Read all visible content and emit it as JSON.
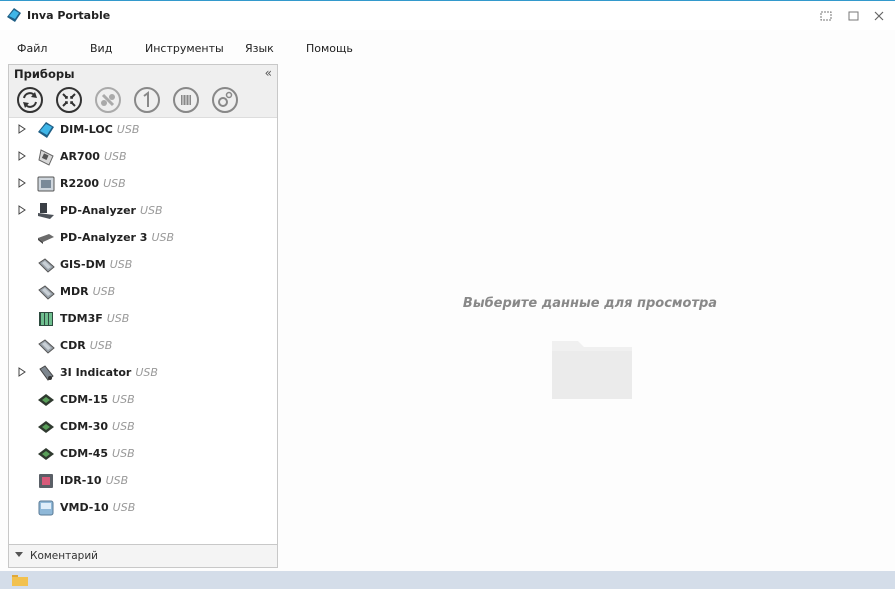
{
  "window": {
    "title": "Inva Portable",
    "accent": "#3399cc",
    "buttons": {
      "restore_icon": "restore-icon",
      "maximize_icon": "maximize-icon",
      "close_icon": "close-icon"
    }
  },
  "menu": {
    "items": [
      {
        "label": "Файл"
      },
      {
        "label": "Вид"
      },
      {
        "label": "Инструменты"
      },
      {
        "label": "Язык"
      },
      {
        "label": "Помощь"
      }
    ]
  },
  "sidebar": {
    "title": "Приборы",
    "collapse_glyph": "«",
    "toolbar": [
      {
        "name": "refresh-icon"
      },
      {
        "name": "collapse-all-icon"
      },
      {
        "name": "connect-icon"
      },
      {
        "name": "info-icon"
      },
      {
        "name": "device-memory-icon"
      },
      {
        "name": "settings-icon"
      }
    ],
    "devices": [
      {
        "name": "DIM-LOC",
        "conn": "USB",
        "expandable": true,
        "icon": "dim-loc-icon"
      },
      {
        "name": "AR700",
        "conn": "USB",
        "expandable": true,
        "icon": "ar700-icon"
      },
      {
        "name": "R2200",
        "conn": "USB",
        "expandable": true,
        "icon": "r2200-icon"
      },
      {
        "name": "PD-Analyzer",
        "conn": "USB",
        "expandable": true,
        "icon": "pd-analyzer-icon"
      },
      {
        "name": "PD-Analyzer 3",
        "conn": "USB",
        "expandable": false,
        "icon": "pd-analyzer3-icon"
      },
      {
        "name": "GIS-DM",
        "conn": "USB",
        "expandable": false,
        "icon": "gis-dm-icon"
      },
      {
        "name": "MDR",
        "conn": "USB",
        "expandable": false,
        "icon": "mdr-icon"
      },
      {
        "name": "TDM3F",
        "conn": "USB",
        "expandable": false,
        "icon": "tdm3f-icon"
      },
      {
        "name": "CDR",
        "conn": "USB",
        "expandable": false,
        "icon": "cdr-icon"
      },
      {
        "name": "3I Indicator",
        "conn": "USB",
        "expandable": true,
        "icon": "3i-indicator-icon"
      },
      {
        "name": "CDM-15",
        "conn": "USB",
        "expandable": false,
        "icon": "cdm-15-icon"
      },
      {
        "name": "CDM-30",
        "conn": "USB",
        "expandable": false,
        "icon": "cdm-30-icon"
      },
      {
        "name": "CDM-45",
        "conn": "USB",
        "expandable": false,
        "icon": "cdm-45-icon"
      },
      {
        "name": "IDR-10",
        "conn": "USB",
        "expandable": false,
        "icon": "idr-10-icon"
      },
      {
        "name": "VMD-10",
        "conn": "USB",
        "expandable": false,
        "icon": "vmd-10-icon"
      }
    ],
    "footer_label": "Коментарий"
  },
  "main": {
    "placeholder": "Выберите данные для просмотра",
    "placeholder_icon": "folder-icon"
  },
  "statusbar": {
    "icon": "status-folder-icon",
    "color": "#d4dde9"
  }
}
